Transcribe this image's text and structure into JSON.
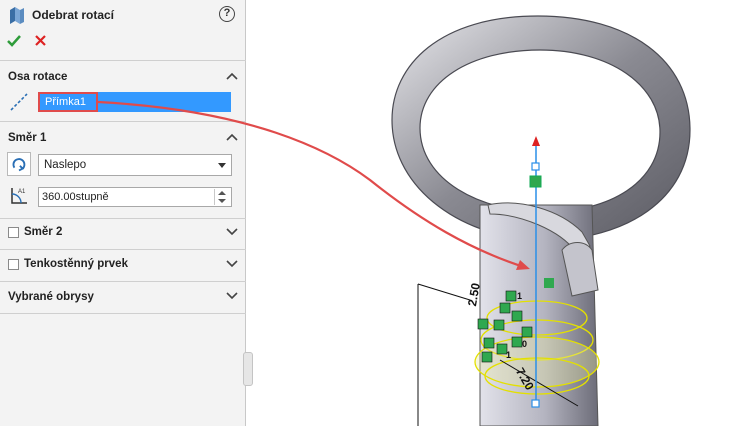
{
  "property_manager": {
    "title": "Odebrat rotací",
    "help_symbol": "?",
    "axis_section": {
      "title": "Osa rotace",
      "selection": "Přímka1"
    },
    "direction1_section": {
      "title": "Směr 1",
      "end_condition": "Naslepo",
      "angle": "360.00stupně"
    },
    "direction2": {
      "label": "Směr 2",
      "checked": false
    },
    "thin_feature": {
      "label": "Tenkostěnný prvek",
      "checked": false
    },
    "selected_contours": {
      "title": "Vybrané obrysy"
    }
  },
  "sketch_annotations": {
    "dim1": "2.50",
    "dim2": "7.20",
    "label_0": "0",
    "label_1": "1",
    "label_1b": "1"
  },
  "colors": {
    "accent_selection": "#3399ff",
    "callout_red": "#e04b4b",
    "sketch_yellow": "#e3e000",
    "sketch_green": "#2fa84f",
    "axis_blue": "#2a8fe8"
  },
  "icons": [
    "revolve-cut-icon",
    "help-icon",
    "ok-check-icon",
    "cancel-x-icon",
    "axis-line-icon",
    "reverse-direction-icon",
    "angle-icon",
    "chevron-up-icon",
    "chevron-down-icon"
  ]
}
